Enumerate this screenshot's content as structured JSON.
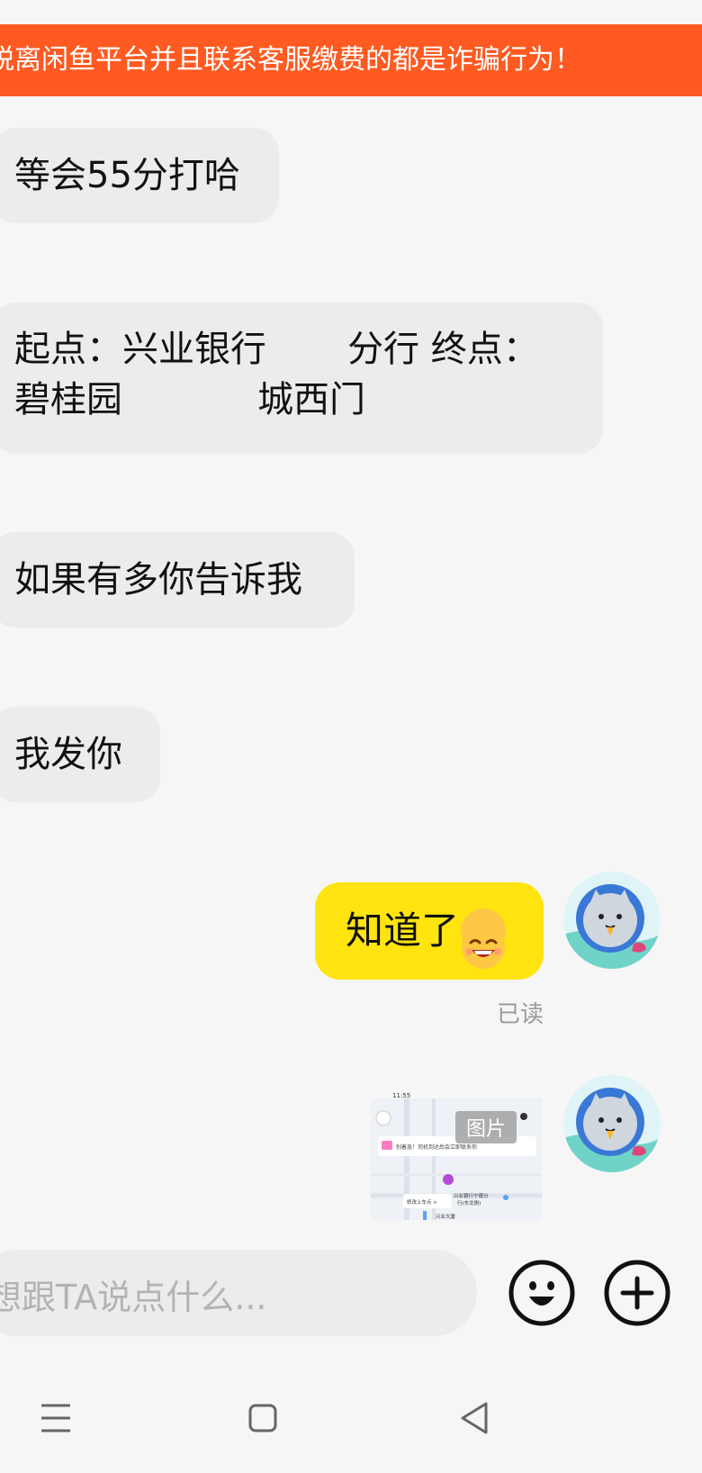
{
  "banner": {
    "text": "脱离闲鱼平台并且联系客服缴费的都是诈骗行为！"
  },
  "messages": [
    {
      "text": "等会55分打哈"
    },
    {
      "line1_a": "起点：兴业银行",
      "line1_b": "分行 终点：",
      "line2_a": "碧桂园",
      "line2_b": "城西门"
    },
    {
      "text": "如果有多你告诉我"
    },
    {
      "text": "我发你"
    }
  ],
  "my_message": {
    "text": "知道了",
    "emoji": "grin-emoji",
    "status": "已读"
  },
  "image_message": {
    "label": "图片",
    "screenshot": {
      "time": "11:55",
      "notice": "别着急！司机到达后会立即联系你",
      "chip": "修改上车点 >",
      "place1": "兴业银行宁德分行",
      "place2": "行(东北侧)",
      "place3": "兴业大厦"
    }
  },
  "composer": {
    "placeholder": "想跟TA说点什么...",
    "emoji_button": "emoji-icon",
    "plus_button": "plus-icon"
  },
  "navbar": {
    "menu": "menu-icon",
    "home": "home-icon",
    "back": "back-icon"
  },
  "colors": {
    "banner": "#ff5a22",
    "my_bubble": "#ffe40f",
    "their_bubble": "#ececec",
    "background": "#f6f6f6"
  }
}
